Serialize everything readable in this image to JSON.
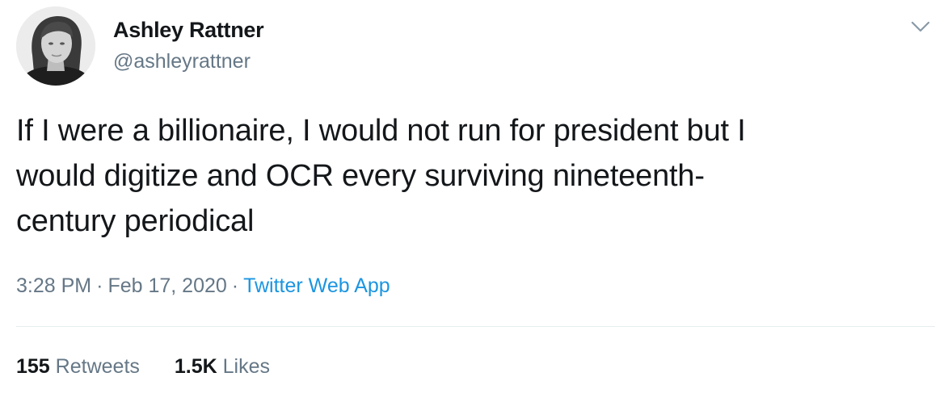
{
  "tweet": {
    "author": {
      "display_name": "Ashley Rattner",
      "handle": "@ashleyrattner"
    },
    "text": "If I were a billionaire, I would not run for president but I\nwould digitize and OCR every surviving nineteenth-\ncentury periodical",
    "time": "3:28 PM",
    "date": "Feb 17, 2020",
    "separator": "·",
    "source": "Twitter Web App",
    "stats": {
      "retweets_count": "155",
      "retweets_label": "Retweets",
      "likes_count": "1.5K",
      "likes_label": "Likes"
    }
  },
  "icons": {
    "menu": "chevron-down-icon",
    "avatar": "avatar"
  },
  "colors": {
    "text_primary": "#14171a",
    "text_secondary": "#657786",
    "link": "#1b95e0",
    "divider": "#e6ecf0"
  }
}
